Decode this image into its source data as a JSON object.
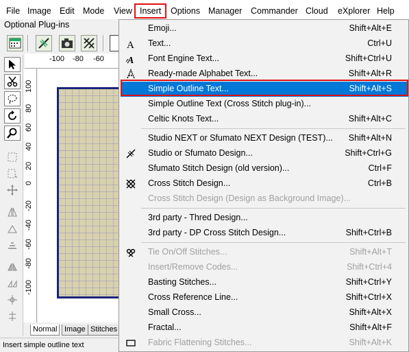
{
  "menubar": {
    "items": [
      {
        "label": "File"
      },
      {
        "label": "Image"
      },
      {
        "label": "Edit"
      },
      {
        "label": "Mode"
      },
      {
        "label": "View"
      },
      {
        "label": "Insert"
      },
      {
        "label": "Options"
      },
      {
        "label": "Manager"
      },
      {
        "label": "Commander"
      },
      {
        "label": "Cloud"
      },
      {
        "label": "eXplorer"
      },
      {
        "label": "Help"
      }
    ],
    "active": "Insert",
    "highlight_color": "#e01010"
  },
  "subtitle": "Optional Plug-ins",
  "ruler": {
    "horizontal": [
      "-100",
      "-80",
      "-60"
    ],
    "vertical": [
      "100",
      "80",
      "60",
      "40",
      "20",
      "0",
      "-20",
      "-40",
      "-60",
      "-80",
      "-100"
    ]
  },
  "tabs": [
    {
      "label": "Normal"
    },
    {
      "label": "Image"
    },
    {
      "label": "Stitches"
    }
  ],
  "status": "Insert simple outline text",
  "insert_menu": {
    "items": [
      {
        "label": "Emoji...",
        "shortcut": "Shift+Alt+E",
        "icon": "none"
      },
      {
        "label": "Text...",
        "shortcut": "Ctrl+U",
        "icon": "text-A-icon"
      },
      {
        "label": "Font Engine Text...",
        "shortcut": "Shift+Ctrl+U",
        "icon": "font-engine-icon"
      },
      {
        "label": "Ready-made Alphabet Text...",
        "shortcut": "Shift+Alt+R",
        "icon": "alphabet-icon"
      },
      {
        "label": "Simple Outline Text...",
        "shortcut": "Shift+Alt+S",
        "icon": "none"
      },
      {
        "label": "Simple Outline Text (Cross Stitch plug-in)...",
        "shortcut": "",
        "icon": "none"
      },
      {
        "label": "Celtic Knots Text...",
        "shortcut": "Shift+Alt+C",
        "icon": "none"
      },
      {
        "label": "Studio NEXT or Sfumato NEXT Design (TEST)...",
        "shortcut": "Shift+Alt+N",
        "icon": "none"
      },
      {
        "label": "Studio or Sfumato Design...",
        "shortcut": "Shift+Ctrl+G",
        "icon": "studio-icon"
      },
      {
        "label": "Sfumato Stitch Design (old version)...",
        "shortcut": "Ctrl+F",
        "icon": "none"
      },
      {
        "label": "Cross Stitch Design...",
        "shortcut": "Ctrl+B",
        "icon": "cross-stitch-icon"
      },
      {
        "label": "Cross Stitch Design (Design as Background Image)...",
        "shortcut": "",
        "icon": "none"
      },
      {
        "label": "3rd party - Thred Design...",
        "shortcut": "",
        "icon": "none"
      },
      {
        "label": "3rd party - DP Cross Stitch Design...",
        "shortcut": "Shift+Ctrl+B",
        "icon": "none"
      },
      {
        "label": "Tie On/Off Stitches...",
        "shortcut": "Shift+Alt+T",
        "icon": "tie-stitch-icon"
      },
      {
        "label": "Insert/Remove Codes...",
        "shortcut": "Shift+Ctrl+4",
        "icon": "none"
      },
      {
        "label": "Basting Stitches...",
        "shortcut": "Shift+Ctrl+Y",
        "icon": "none"
      },
      {
        "label": "Cross Reference Line...",
        "shortcut": "Shift+Ctrl+X",
        "icon": "none"
      },
      {
        "label": "Small Cross...",
        "shortcut": "Shift+Alt+X",
        "icon": "none"
      },
      {
        "label": "Fractal...",
        "shortcut": "Shift+Alt+F",
        "icon": "none"
      },
      {
        "label": "Fabric Flattening Stitches...",
        "shortcut": "Shift+Alt+K",
        "icon": "fabric-icon"
      }
    ],
    "selected": "Simple Outline Text...",
    "selected_color": "#0078d7"
  }
}
